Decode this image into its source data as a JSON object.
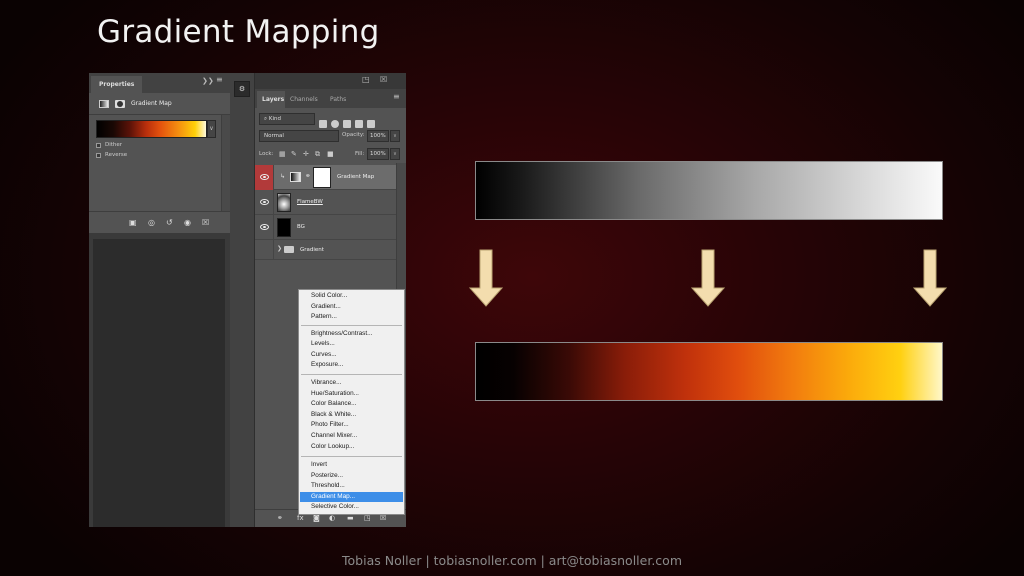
{
  "slide": {
    "title": "Gradient Mapping",
    "footer": "Tobias Noller | tobiasnoller.com | art@tobiasnoller.com"
  },
  "properties_panel": {
    "tab": "Properties",
    "header_label": "Gradient Map",
    "options": [
      {
        "label": "Dither",
        "checked": false
      },
      {
        "label": "Reverse",
        "checked": false
      }
    ]
  },
  "layers_panel": {
    "tabs": [
      "Layers",
      "Channels",
      "Paths"
    ],
    "active_tab": "Layers",
    "filter_kind": "Kind",
    "blend_mode": "Normal",
    "opacity_label": "Opacity:",
    "opacity": "100%",
    "lock_label": "Lock:",
    "fill_label": "Fill:",
    "fill": "100%",
    "layers": [
      {
        "name": "Gradient Map",
        "visible": true,
        "selected": true
      },
      {
        "name": "FlameBW",
        "visible": true,
        "selected": false
      },
      {
        "name": "BG",
        "visible": true,
        "selected": false
      },
      {
        "name": "Gradient",
        "visible": false,
        "selected": false
      }
    ]
  },
  "adjustment_menu": {
    "groups": [
      [
        "Solid Color...",
        "Gradient...",
        "Pattern..."
      ],
      [
        "Brightness/Contrast...",
        "Levels...",
        "Curves...",
        "Exposure..."
      ],
      [
        "Vibrance...",
        "Hue/Saturation...",
        "Color Balance...",
        "Black & White...",
        "Photo Filter...",
        "Channel Mixer...",
        "Color Lookup..."
      ],
      [
        "Invert",
        "Posterize...",
        "Threshold...",
        "Gradient Map...",
        "Selective Color..."
      ]
    ],
    "highlighted": "Gradient Map..."
  },
  "colors": {
    "highlight": "#3d8ee8",
    "active_eye": "#b23a3a",
    "arrow_fill": "#f3ddae"
  }
}
